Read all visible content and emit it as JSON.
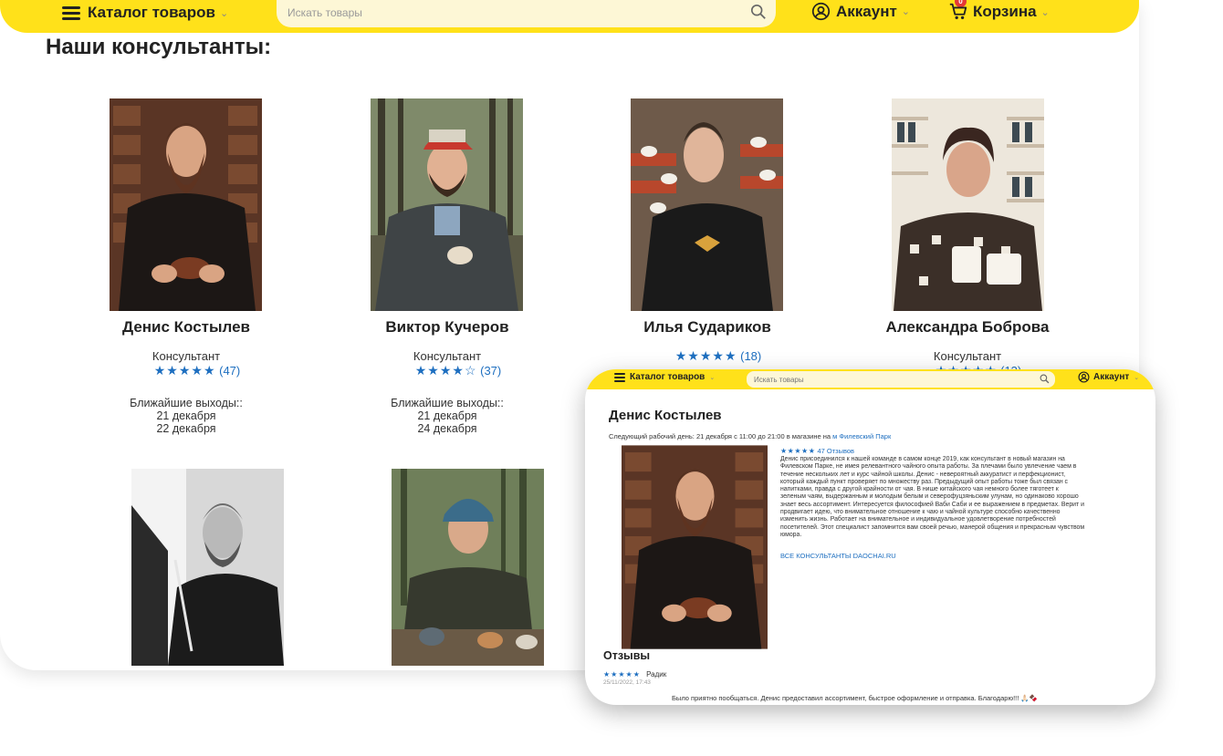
{
  "header": {
    "catalog_label": "Каталог товаров",
    "search_placeholder": "Искать товары",
    "account_label": "Аккаунт",
    "cart_label": "Корзина",
    "cart_count": "0"
  },
  "main": {
    "title": "Наши консультанты:",
    "consultants": [
      {
        "name": "Денис Костылев",
        "role": "Консультант",
        "stars": "★★★★★",
        "rating_count": "(47)",
        "exits_label": "Ближайшие выходы::",
        "exits": [
          "21 декабря",
          "22 декабря"
        ]
      },
      {
        "name": "Виктор Кучеров",
        "role": "Консультант",
        "stars": "★★★★☆",
        "rating_count": "(37)",
        "exits_label": "Ближайшие выходы::",
        "exits": [
          "21 декабря",
          "24 декабря"
        ]
      },
      {
        "name": "Илья Судариков",
        "role": "",
        "stars": "★★★★★",
        "rating_count": "(18)",
        "exits_label": "",
        "exits": []
      },
      {
        "name": "Александра Боброва",
        "role": "Консультант",
        "stars": "★★★★★",
        "rating_count": "(13)",
        "exits_label": "",
        "exits": []
      }
    ]
  },
  "overlay": {
    "header": {
      "catalog_label": "Каталог товаров",
      "search_placeholder": "Искать товары",
      "account_label": "Аккаунт"
    },
    "title": "Денис Костылев",
    "next_day_text": "Следующий рабочий день: 21 декабря с 11:00 до 21:00 в магазине на ",
    "next_day_link": "м Филевский Парк",
    "stars": "★★★★★",
    "reviews_count_label": "47 Отзывов",
    "description": "Денис присоединился к нашей команде в самом конце 2019, как консультант в новый магазин на Филевском Парке, не имея релевантного чайного опыта работы. За плечами было увлечение чаем в течение нескольких лет и курс чайной школы. Денис - невероятный аккуратист и перфекционист, который каждый пункт проверяет по множеству раз. Предыдущий опыт работы тоже был связан с напитками, правда с другой крайности от чая. В нише китайского чая немного более тяготеет к зеленым чаям, выдержанным и молодым белым и северофуцзяньским улунам, но одинаково хорошо знает весь ассортимент. Интересуется философией Ваби Саби и ее выражением в предметах. Верит и продвигает идею, что внимательное отношение к чаю и чайной культуре способно качественно изменить жизнь. Работает на внимательное и индивидуальное удовлетворение потребностей посетителей. Этот специалист запомнится вам своей речью, манерой общения и прекрасным чувством юмора.",
    "all_consultants_link": "ВСЕ КОНСУЛЬТАНТЫ DAOCHAI.RU",
    "reviews_title": "Отзывы",
    "review": {
      "stars": "★★★★★",
      "author": "Радик",
      "date": "25/11/2022, 17:43",
      "text": "Было приятно пообщаться. Денис предоставил ассортимент, быстрое оформление и отправка. Благодарю!!! 🙏🏻🍫"
    }
  }
}
